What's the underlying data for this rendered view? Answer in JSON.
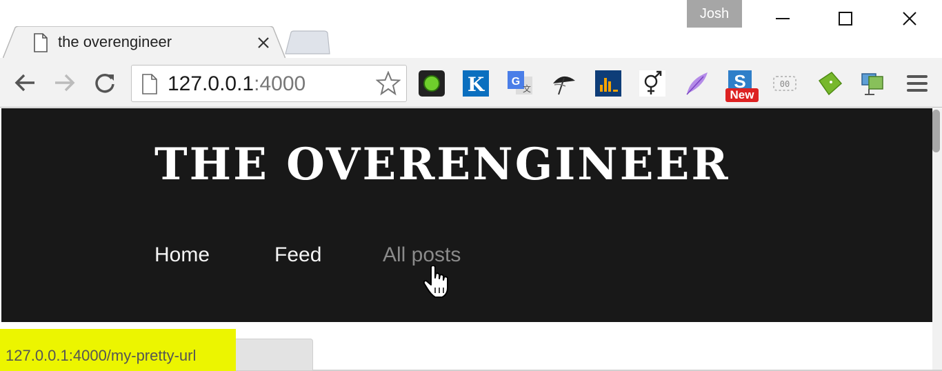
{
  "window": {
    "profile_name": "Josh",
    "controls": [
      "minimize",
      "maximize",
      "close"
    ]
  },
  "tabs": [
    {
      "title": "the overengineer",
      "icon": "page-icon",
      "active": true
    }
  ],
  "toolbar": {
    "back_icon": "arrow-left-icon",
    "forward_icon": "arrow-right-icon",
    "reload_icon": "reload-icon",
    "omnibox": {
      "host": "127.0.0.1",
      "port": ":4000"
    },
    "extensions": [
      "green-dot-extension",
      "k-extension",
      "google-translate-extension",
      "umbrella-extension",
      "bar-chart-extension",
      "gender-symbol-extension",
      "feather-extension",
      "s-new-extension",
      "dotted-box-extension",
      "green-tag-extension",
      "monitor-network-extension"
    ],
    "ext_badge": "New",
    "menu_icon": "hamburger-menu-icon"
  },
  "site": {
    "title": "THE OVERENGINEER",
    "nav": [
      {
        "label": "Home"
      },
      {
        "label": "Feed"
      },
      {
        "label": "All posts"
      }
    ]
  },
  "status": {
    "url": "127.0.0.1:4000/my-pretty-url"
  },
  "colors": {
    "header_bg": "#181818",
    "highlight": "#ecf500",
    "hover_link": "#8a8a8a"
  }
}
